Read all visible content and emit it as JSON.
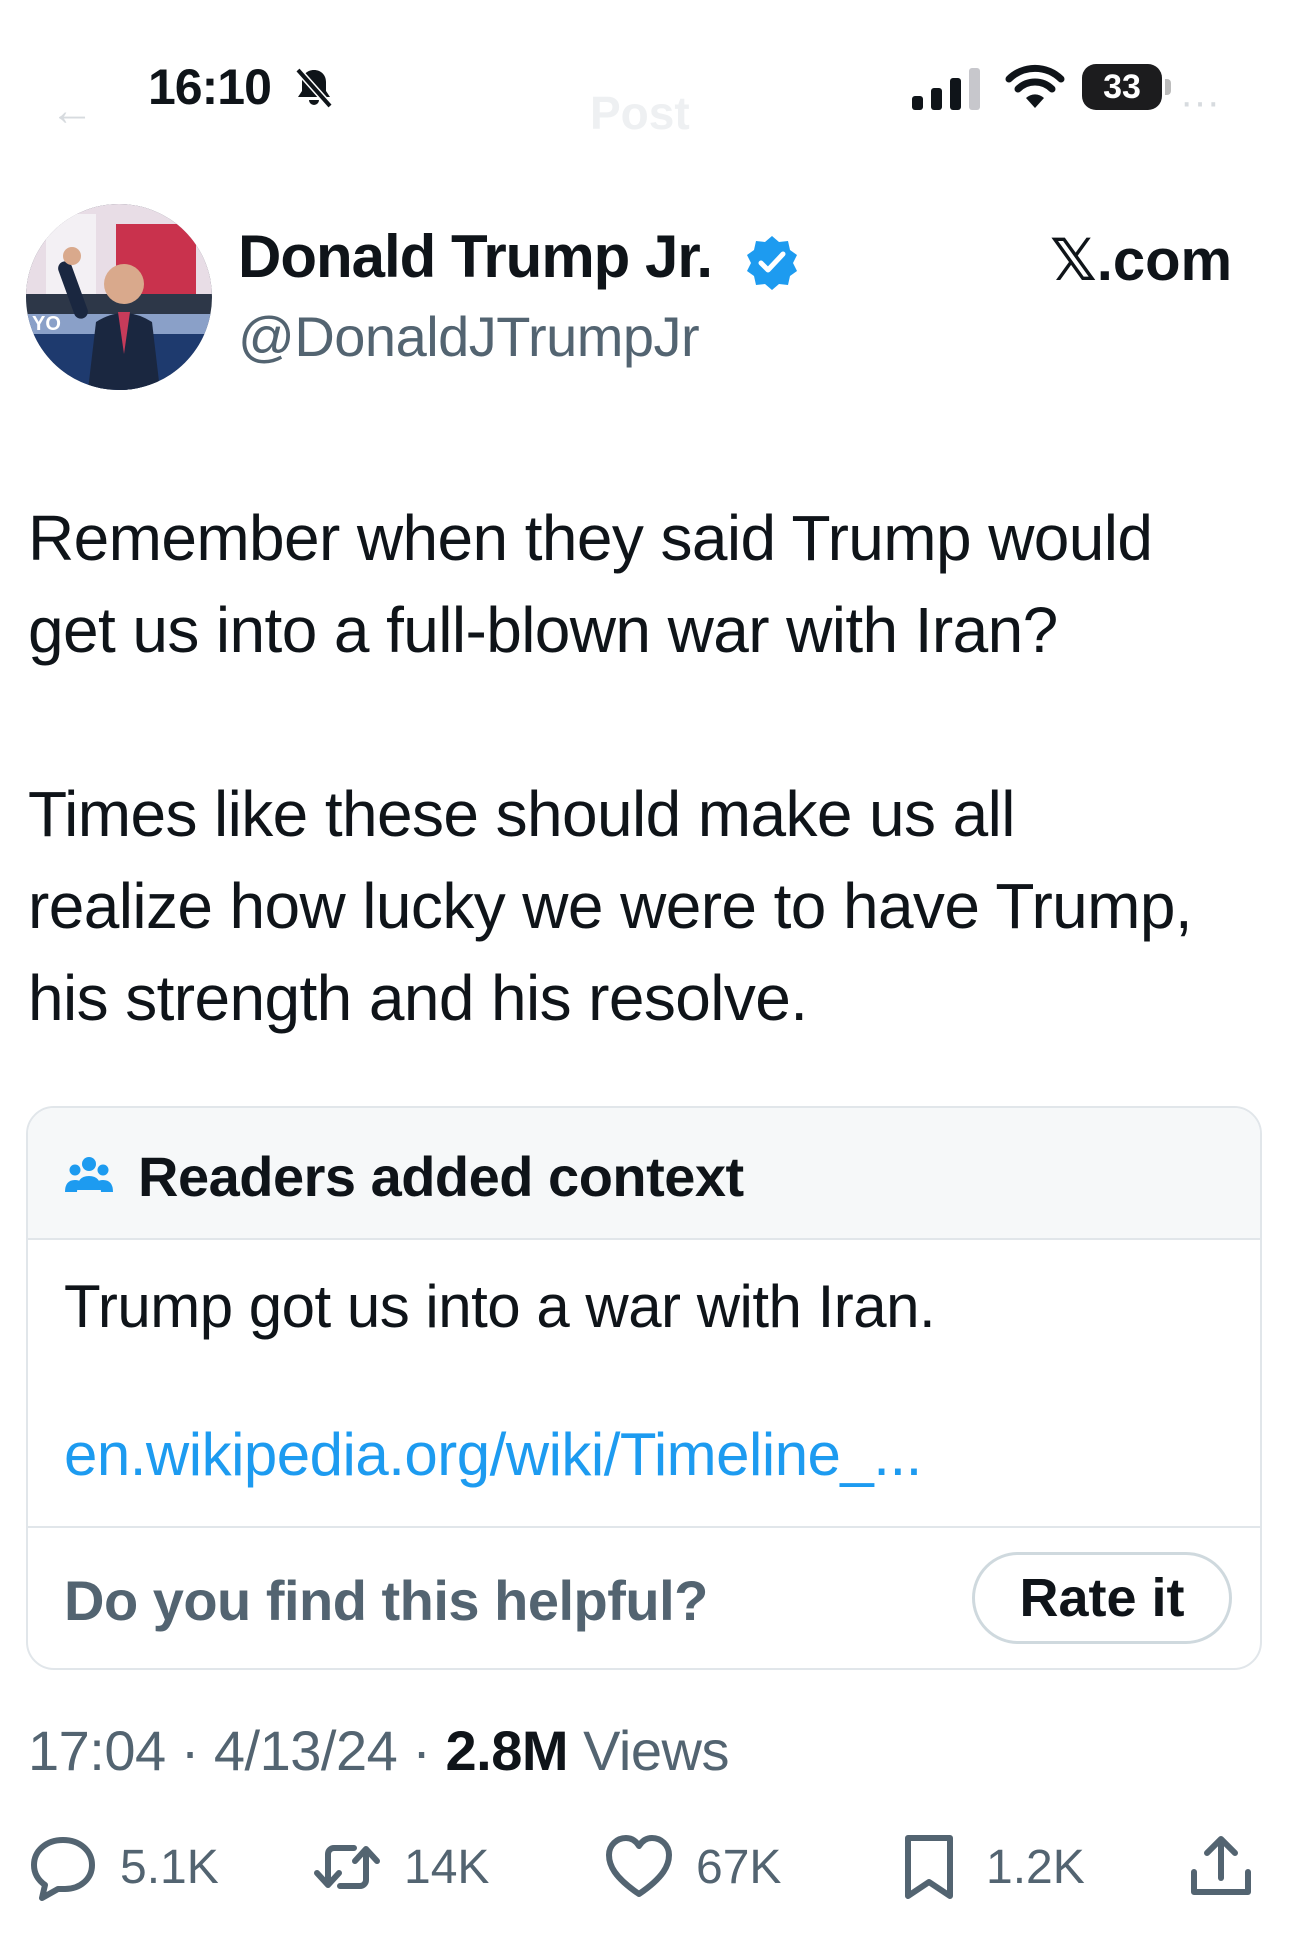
{
  "status_bar": {
    "time": "16:10",
    "battery": "33"
  },
  "nav": {
    "back_glyph": "←",
    "title": "Post",
    "more_glyph": "···"
  },
  "author": {
    "name": "Donald Trump Jr.",
    "handle": "@DonaldJTrumpJr",
    "verified": true
  },
  "brand": "𝕏.com",
  "tweet": {
    "paragraph_1": "Remember when they said Trump would\nget us into a full-blown war with Iran?",
    "paragraph_2": "Times like these should make us all\nrealize how lucky we were to have Trump,\nhis strength and his resolve."
  },
  "note": {
    "header": "Readers added context",
    "text": "Trump got us into a war with Iran.",
    "link": "en.wikipedia.org/wiki/Timeline_...",
    "question": "Do you find this helpful?",
    "rate_label": "Rate it"
  },
  "meta": {
    "time": "17:04",
    "separator": " · ",
    "date": "4/13/24",
    "views_count": "2.8M",
    "views_label": " Views"
  },
  "actions": {
    "replies": "5.1K",
    "reposts": "14K",
    "likes": "67K",
    "bookmarks": "1.2K"
  },
  "colors": {
    "accent": "#1d9bf0",
    "text": "#0f1419",
    "secondary": "#536471",
    "border": "#e1e6ea"
  }
}
